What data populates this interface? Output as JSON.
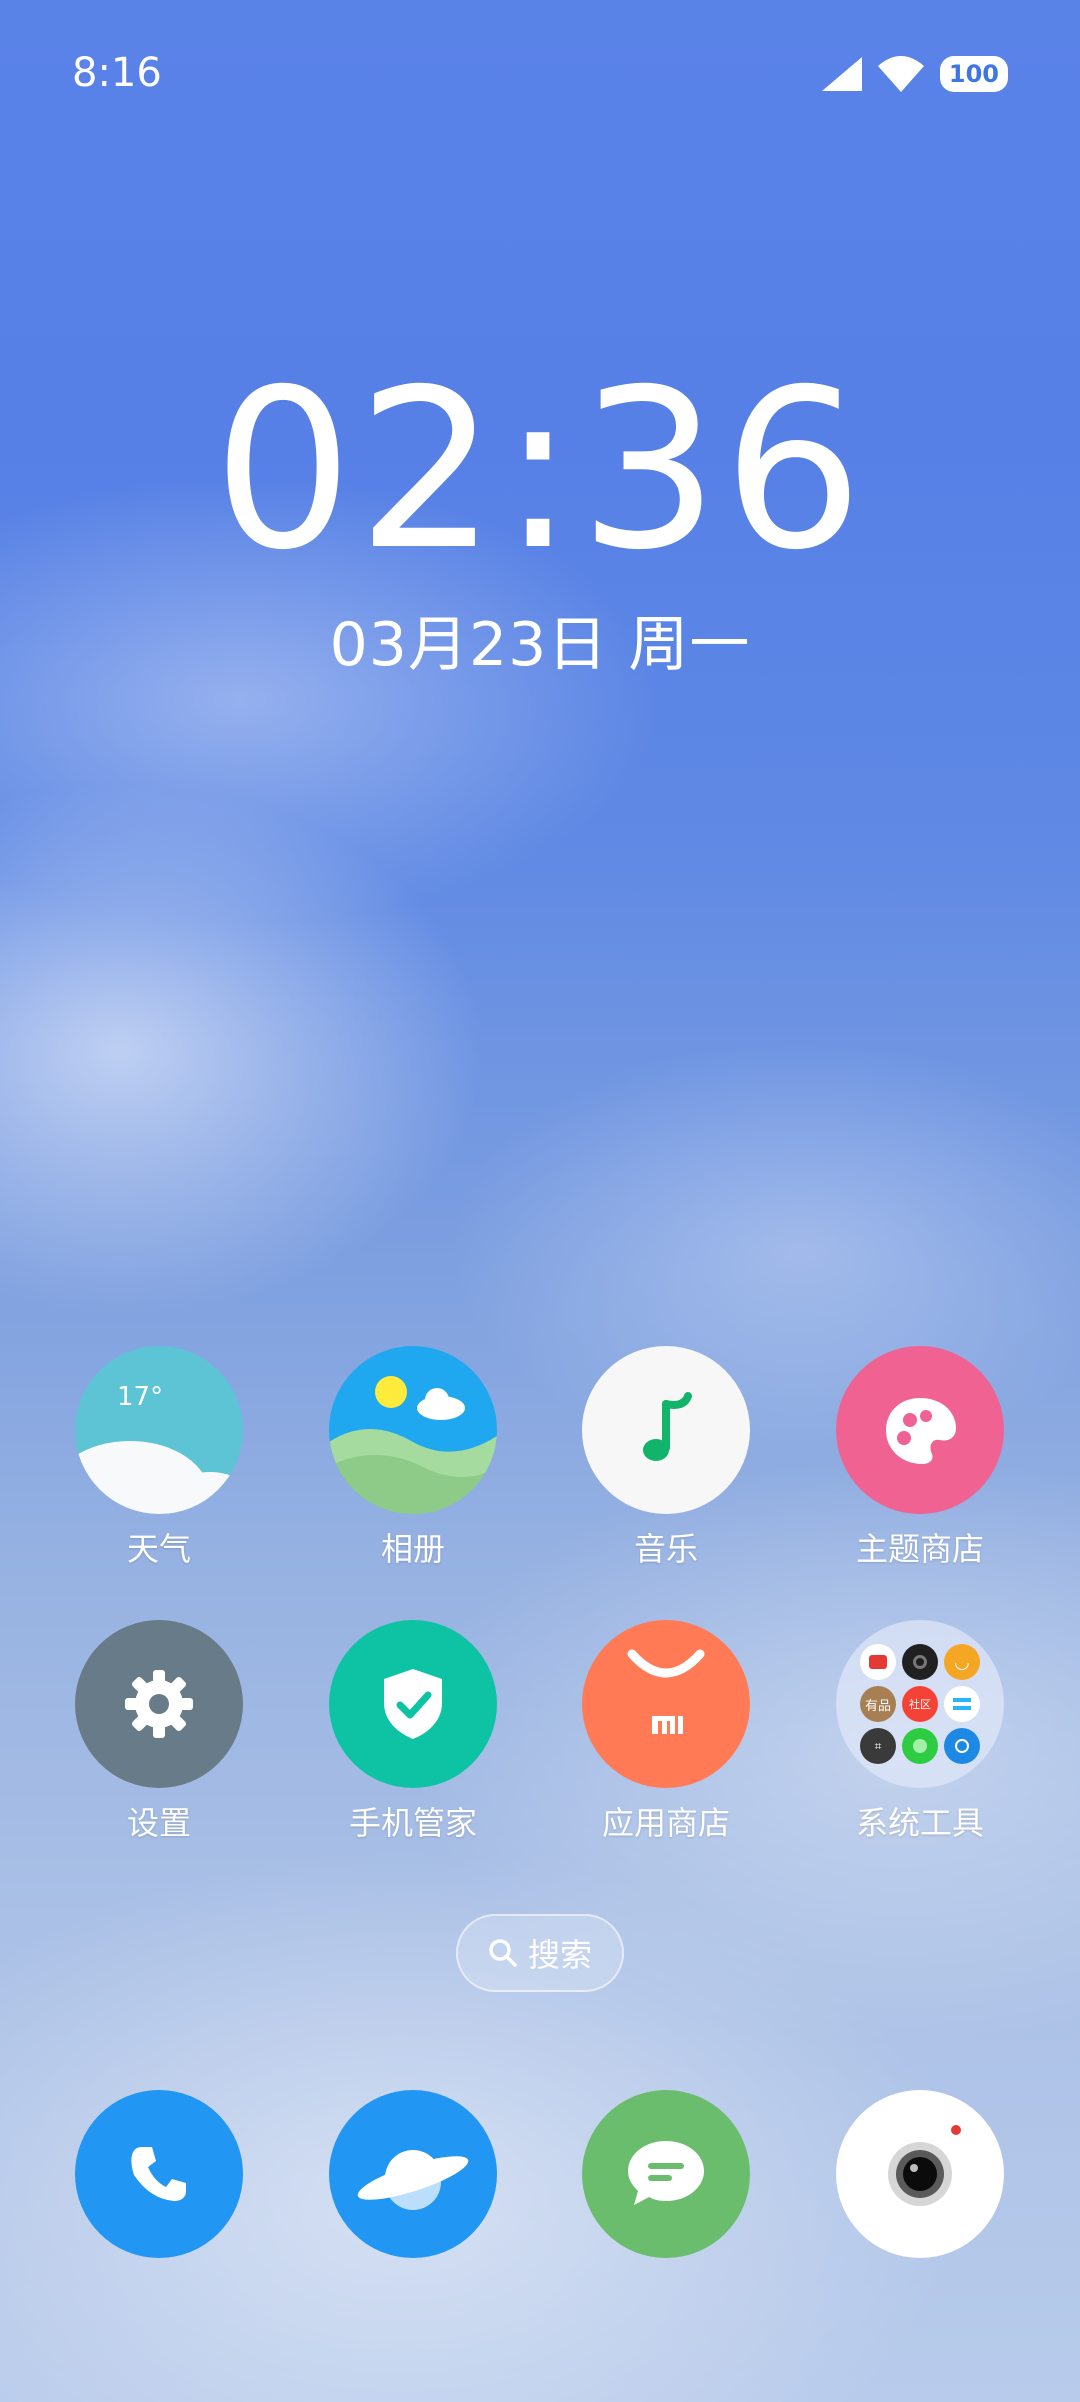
{
  "status_bar": {
    "time": "8:16",
    "battery": "100",
    "icons": [
      "signal-icon",
      "wifi-icon",
      "battery-icon"
    ]
  },
  "clock_widget": {
    "time": "02:36",
    "date": "03月23日 周一"
  },
  "apps": [
    {
      "label": "天气",
      "icon": "weather-icon",
      "temp": "17°"
    },
    {
      "label": "相册",
      "icon": "gallery-icon"
    },
    {
      "label": "音乐",
      "icon": "music-icon"
    },
    {
      "label": "主题商店",
      "icon": "themes-icon"
    },
    {
      "label": "设置",
      "icon": "settings-icon"
    },
    {
      "label": "手机管家",
      "icon": "security-icon"
    },
    {
      "label": "应用商店",
      "icon": "app-store-icon"
    },
    {
      "label": "系统工具",
      "icon": "system-tools-folder-icon",
      "mini_label": "有品"
    }
  ],
  "search": {
    "label": "搜索"
  },
  "dock": [
    {
      "icon": "phone-icon",
      "color": "#2196f3"
    },
    {
      "icon": "browser-icon",
      "color": "#2196f3"
    },
    {
      "icon": "messages-icon",
      "color": "#6bbd6e"
    },
    {
      "icon": "camera-icon",
      "color": "#ffffff"
    }
  ],
  "colors": {
    "weather": "#5cc4d4",
    "gallery": "#1fa8f0",
    "music": "#f7f7f7",
    "themes": "#f06292",
    "settings": "#677c88",
    "security": "#0ec3a3",
    "app_store": "#ff7a55"
  }
}
